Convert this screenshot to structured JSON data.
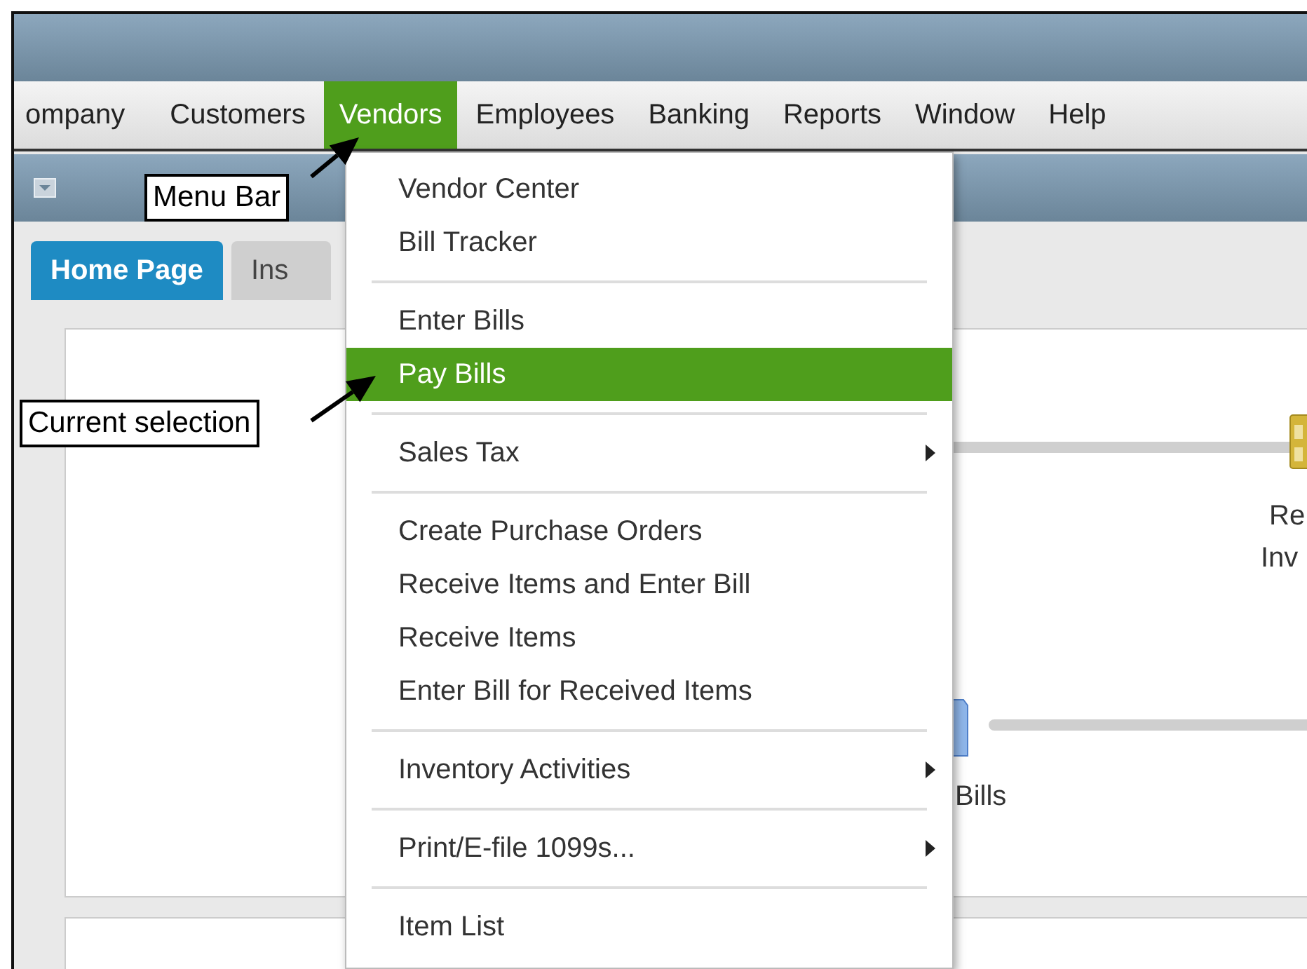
{
  "menu_bar": {
    "items": [
      {
        "label": "ompany",
        "selected": false
      },
      {
        "label": "Customers",
        "selected": false
      },
      {
        "label": "Vendors",
        "selected": true
      },
      {
        "label": "Employees",
        "selected": false
      },
      {
        "label": "Banking",
        "selected": false
      },
      {
        "label": "Reports",
        "selected": false
      },
      {
        "label": "Window",
        "selected": false
      },
      {
        "label": "Help",
        "selected": false
      }
    ]
  },
  "window": {
    "tabs": [
      {
        "label": "Home Page",
        "selected": true
      },
      {
        "label": "Ins",
        "selected": false
      }
    ]
  },
  "home_page": {
    "receive_inventory_label": [
      "Re",
      "Inv"
    ],
    "bills_label": "Bills"
  },
  "vendors_menu": {
    "items": [
      {
        "kind": "item",
        "label": "Vendor Center",
        "selected": false,
        "submenu": false
      },
      {
        "kind": "item",
        "label": "Bill Tracker",
        "selected": false,
        "submenu": false
      },
      {
        "kind": "separator"
      },
      {
        "kind": "item",
        "label": "Enter Bills",
        "selected": false,
        "submenu": false
      },
      {
        "kind": "item",
        "label": "Pay Bills",
        "selected": true,
        "submenu": false
      },
      {
        "kind": "separator"
      },
      {
        "kind": "item",
        "label": "Sales Tax",
        "selected": false,
        "submenu": true
      },
      {
        "kind": "separator"
      },
      {
        "kind": "item",
        "label": "Create Purchase Orders",
        "selected": false,
        "submenu": false
      },
      {
        "kind": "item",
        "label": "Receive Items and Enter Bill",
        "selected": false,
        "submenu": false
      },
      {
        "kind": "item",
        "label": "Receive Items",
        "selected": false,
        "submenu": false
      },
      {
        "kind": "item",
        "label": "Enter Bill for Received Items",
        "selected": false,
        "submenu": false
      },
      {
        "kind": "separator"
      },
      {
        "kind": "item",
        "label": "Inventory Activities",
        "selected": false,
        "submenu": true
      },
      {
        "kind": "separator"
      },
      {
        "kind": "item",
        "label": "Print/E-file 1099s...",
        "selected": false,
        "submenu": true
      },
      {
        "kind": "separator"
      },
      {
        "kind": "item",
        "label": "Item List",
        "selected": false,
        "submenu": false
      }
    ]
  },
  "callouts": [
    {
      "text": "Menu Bar"
    },
    {
      "text": "Current selection"
    }
  ]
}
